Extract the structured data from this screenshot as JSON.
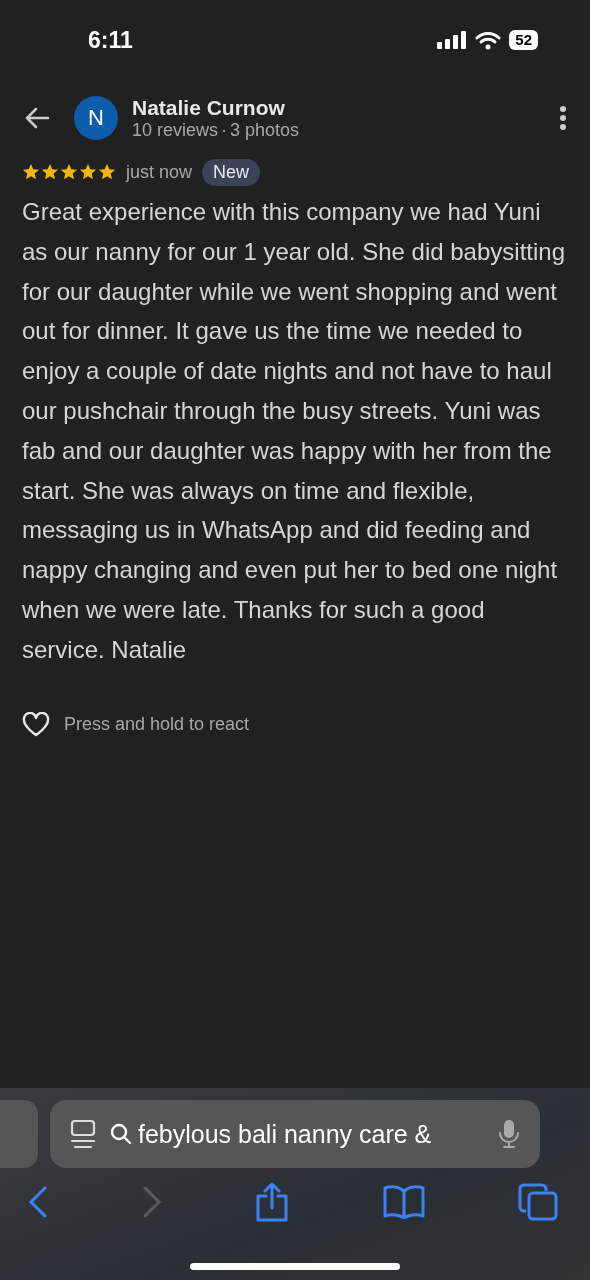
{
  "status_bar": {
    "time": "6:11",
    "battery": "52"
  },
  "reviewer": {
    "initial": "N",
    "name": "Natalie Curnow",
    "reviews": "10 reviews",
    "separator": "·",
    "photos": "3 photos"
  },
  "review": {
    "stars": 5,
    "time": "just now",
    "badge": "New",
    "text": "Great experience with this company we had Yuni as our nanny for our 1 year old. She did babysitting for our daughter while we went shopping and went out for dinner. It gave us the time we needed to enjoy a couple of date nights and not have to haul our pushchair through the busy streets. Yuni was fab and our daughter was happy with her from the start. She was always on time and flexible, messaging us in WhatsApp and did feeding and nappy changing and even put her to bed one night when we were late. Thanks for such a good service. Natalie",
    "react_hint": "Press and hold to react"
  },
  "browser_bar": {
    "address": "febylous bali nanny care &",
    "forward_disabled": true
  }
}
